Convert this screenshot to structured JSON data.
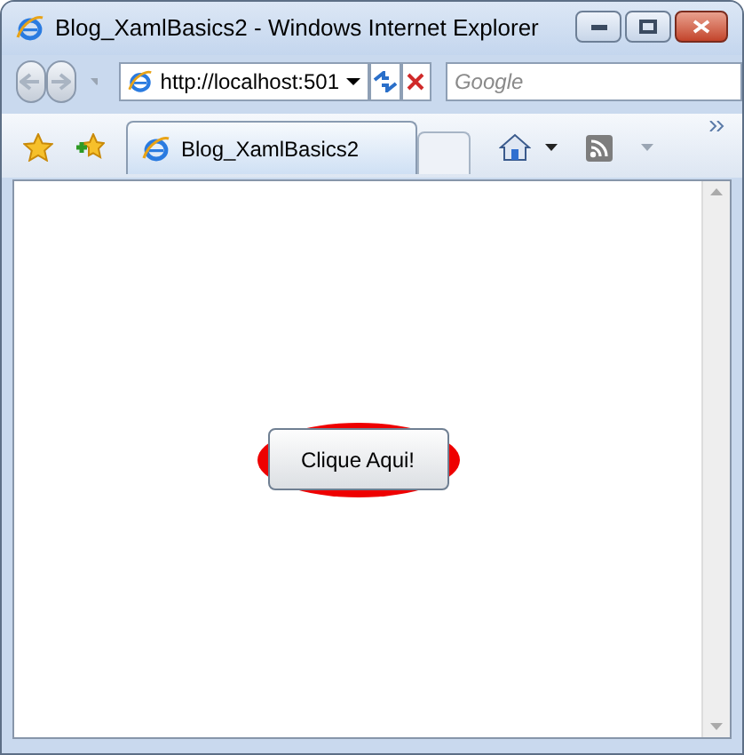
{
  "window": {
    "title": "Blog_XamlBasics2 - Windows Internet Explorer"
  },
  "address_bar": {
    "value": "http://localhost:501"
  },
  "search": {
    "placeholder": "Google"
  },
  "tabs": [
    {
      "label": "Blog_XamlBasics2",
      "selected": true
    }
  ],
  "page": {
    "button": {
      "label": "Clique Aqui!"
    }
  }
}
